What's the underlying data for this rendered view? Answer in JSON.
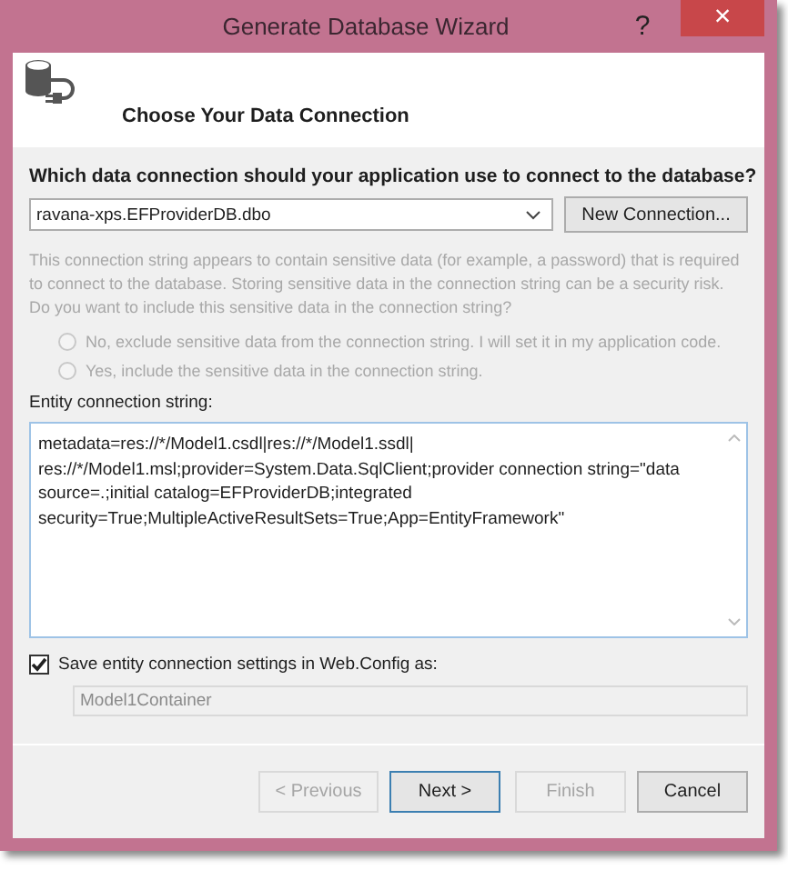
{
  "window": {
    "title": "Generate Database Wizard",
    "help": "?",
    "close": "×"
  },
  "header": {
    "title": "Choose Your Data Connection"
  },
  "question": "Which data connection should your application use to connect to the database?",
  "connection_select": {
    "value": "ravana-xps.EFProviderDB.dbo"
  },
  "new_connection_button": {
    "label": "New Connection...",
    "disabled": false
  },
  "sensitive_notice": {
    "text": "This connection string appears to contain sensitive data (for example, a password) that is required to connect to the database. Storing sensitive data in the connection string can be a security risk. Do you want to include this sensitive data in the connection string?",
    "disabled": true
  },
  "sensitive_options": [
    {
      "label": "No, exclude sensitive data from the connection string. I will set it in my application code.",
      "selected": false,
      "disabled": true
    },
    {
      "label": "Yes, include the sensitive data in the connection string.",
      "selected": false,
      "disabled": true
    }
  ],
  "entity_connection": {
    "label": "Entity connection string:",
    "lines": [
      "metadata=res://*/Model1.csdl|res://*/Model1.ssdl|",
      "res://*/Model1.msl;provider=System.Data.SqlClient;provider connection string=\"data",
      "source=.;initial catalog=EFProviderDB;integrated",
      "security=True;MultipleActiveResultSets=True;App=EntityFramework\""
    ]
  },
  "save_settings": {
    "label": "Save entity connection settings in Web.Config as:",
    "checked": true
  },
  "config_name": {
    "value": "Model1Container",
    "disabled": true
  },
  "buttons": [
    {
      "label": "< Previous",
      "disabled": true,
      "default": false
    },
    {
      "label": "Next >",
      "disabled": false,
      "default": true
    },
    {
      "label": "Finish",
      "disabled": true,
      "default": false
    },
    {
      "label": "Cancel",
      "disabled": false,
      "default": false
    }
  ]
}
